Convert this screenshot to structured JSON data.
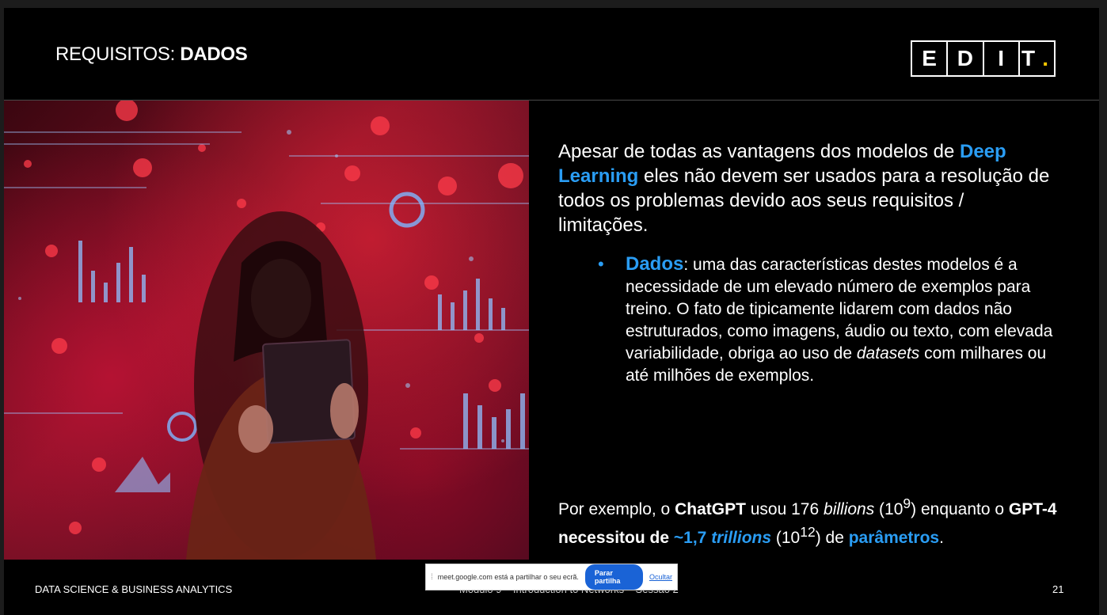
{
  "slide": {
    "title_prefix": "REQUISITOS: ",
    "title_bold": "DADOS",
    "logo_letters": [
      "E",
      "D",
      "I",
      "T"
    ],
    "logo_dot": ".",
    "paragraph1": {
      "a": "Apesar de todas as vantagens dos modelos de ",
      "b": "Deep Learning",
      "c": " eles não devem ser usados para a resolução de todos os problemas devido aos seus requisitos / limitações."
    },
    "bullet": {
      "marker": "•",
      "term": "Dados",
      "a": ": uma das características destes modelos é a necessidade de um elevado número de exemplos para treino. O fato de tipicamente lidarem com dados não estruturados, como imagens, áudio ou texto, com elevada variabilidade, obriga ao uso de ",
      "italic": "datasets",
      "b": " com milhares ou até milhões de exemplos."
    },
    "example": {
      "t1": "Por exemplo, o ",
      "t2": "ChatGPT",
      "t3": " usou 176 ",
      "t4": "billions",
      "t5": " (10",
      "t6": "9",
      "t7": ") enquanto o ",
      "t8": "GPT-4 necessitou de ",
      "t9": "~1,7 ",
      "t10": "trillions",
      "t11": " (10",
      "t12": "12",
      "t13": ") de ",
      "t14": "parâmetros",
      "t15": "."
    },
    "footer_left": "DATA SCIENCE & BUSINESS ANALYTICS",
    "footer_mid": "Módulo 9 – Introduction to Networks – Sessão 2",
    "page_number": "21"
  },
  "share_bar": {
    "message": "meet.google.com está a partilhar o seu ecrã.",
    "stop_label": "Parar partilha",
    "hide_label": "Ocultar"
  },
  "colors": {
    "accent": "#2a9df4",
    "logo_dot": "#f2c500"
  }
}
